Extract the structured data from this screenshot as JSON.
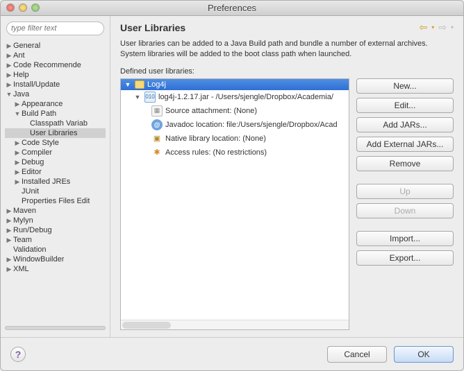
{
  "window": {
    "title": "Preferences"
  },
  "sidebar": {
    "filter_placeholder": "type filter text",
    "items": [
      {
        "label": "General",
        "depth": 0,
        "arw": "▶"
      },
      {
        "label": "Ant",
        "depth": 0,
        "arw": "▶"
      },
      {
        "label": "Code Recommende",
        "depth": 0,
        "arw": "▶"
      },
      {
        "label": "Help",
        "depth": 0,
        "arw": "▶"
      },
      {
        "label": "Install/Update",
        "depth": 0,
        "arw": "▶"
      },
      {
        "label": "Java",
        "depth": 0,
        "arw": "▼"
      },
      {
        "label": "Appearance",
        "depth": 1,
        "arw": "▶"
      },
      {
        "label": "Build Path",
        "depth": 1,
        "arw": "▼"
      },
      {
        "label": "Classpath Variab",
        "depth": 2,
        "arw": ""
      },
      {
        "label": "User Libraries",
        "depth": 2,
        "arw": "",
        "sel": true
      },
      {
        "label": "Code Style",
        "depth": 1,
        "arw": "▶"
      },
      {
        "label": "Compiler",
        "depth": 1,
        "arw": "▶"
      },
      {
        "label": "Debug",
        "depth": 1,
        "arw": "▶"
      },
      {
        "label": "Editor",
        "depth": 1,
        "arw": "▶"
      },
      {
        "label": "Installed JREs",
        "depth": 1,
        "arw": "▶"
      },
      {
        "label": "JUnit",
        "depth": 1,
        "arw": ""
      },
      {
        "label": "Properties Files Edit",
        "depth": 1,
        "arw": ""
      },
      {
        "label": "Maven",
        "depth": 0,
        "arw": "▶"
      },
      {
        "label": "Mylyn",
        "depth": 0,
        "arw": "▶"
      },
      {
        "label": "Run/Debug",
        "depth": 0,
        "arw": "▶"
      },
      {
        "label": "Team",
        "depth": 0,
        "arw": "▶"
      },
      {
        "label": "Validation",
        "depth": 0,
        "arw": ""
      },
      {
        "label": "WindowBuilder",
        "depth": 0,
        "arw": "▶"
      },
      {
        "label": "XML",
        "depth": 0,
        "arw": "▶"
      }
    ]
  },
  "page": {
    "heading": "User Libraries",
    "description": "User libraries can be added to a Java Build path and bundle a number of external archives. System libraries will be added to the boot class path when launched.",
    "defined_label": "Defined user libraries:",
    "lib": {
      "name": "Log4j",
      "jar": "log4j-1.2.17.jar - /Users/sjengle/Dropbox/Academia/",
      "source": "Source attachment: (None)",
      "javadoc": "Javadoc location: file:/Users/sjengle/Dropbox/Acad",
      "native": "Native library location: (None)",
      "access": "Access rules: (No restrictions)"
    },
    "buttons": {
      "new": "New...",
      "edit": "Edit...",
      "addjars": "Add JARs...",
      "addext": "Add External JARs...",
      "remove": "Remove",
      "up": "Up",
      "down": "Down",
      "import": "Import...",
      "export": "Export..."
    }
  },
  "footer": {
    "cancel": "Cancel",
    "ok": "OK"
  }
}
